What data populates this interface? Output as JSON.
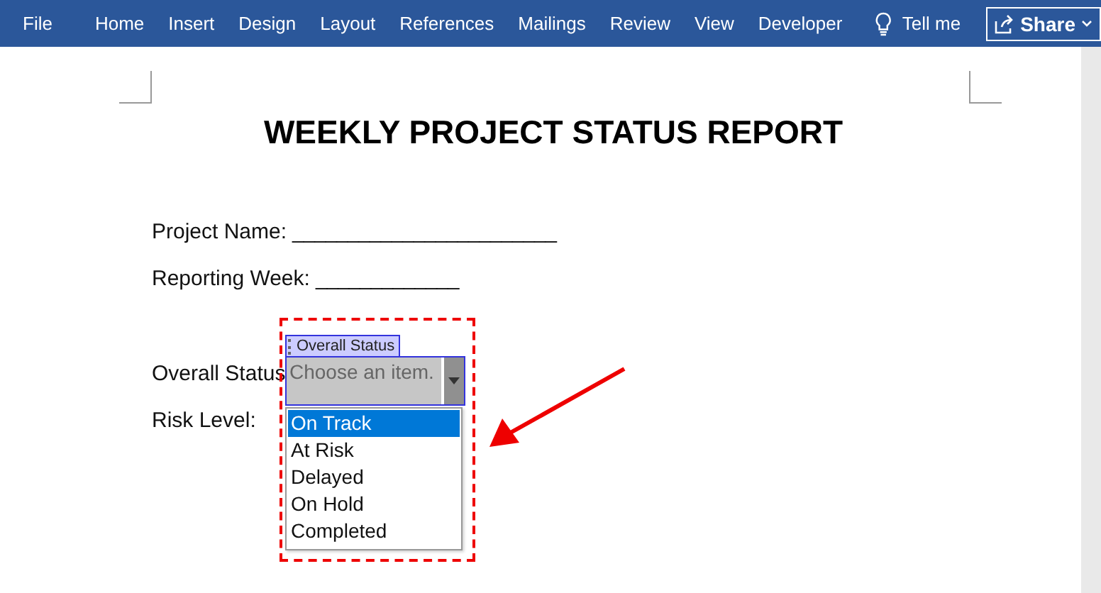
{
  "ribbon": {
    "tabs": [
      {
        "label": "File"
      },
      {
        "label": "Home"
      },
      {
        "label": "Insert"
      },
      {
        "label": "Design"
      },
      {
        "label": "Layout"
      },
      {
        "label": "References"
      },
      {
        "label": "Mailings"
      },
      {
        "label": "Review"
      },
      {
        "label": "View"
      },
      {
        "label": "Developer"
      }
    ],
    "tell_me": "Tell me",
    "share": "Share"
  },
  "document": {
    "title": "WEEKLY PROJECT STATUS REPORT",
    "fields": [
      {
        "label": "Project Name:",
        "blank": "________________________"
      },
      {
        "label": "Reporting Week:",
        "blank": "_____________"
      }
    ],
    "controls": [
      {
        "label": "Overall Status"
      },
      {
        "label": "Risk Level:"
      }
    ]
  },
  "content_control": {
    "tag": "Overall Status",
    "prompt": "Choose an item.",
    "options": [
      {
        "label": "On Track",
        "selected": true
      },
      {
        "label": "At Risk",
        "selected": false
      },
      {
        "label": "Delayed",
        "selected": false
      },
      {
        "label": "On Hold",
        "selected": false
      },
      {
        "label": "Completed",
        "selected": false
      }
    ]
  }
}
